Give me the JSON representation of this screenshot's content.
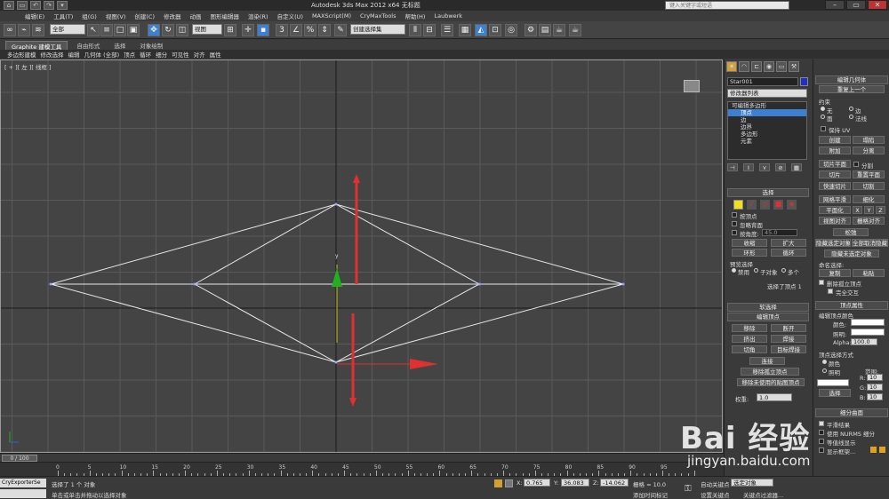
{
  "titlebar": {
    "title": "Autodesk 3ds Max  2012 x64     无标题",
    "search_placeholder": "键入关键字或短语",
    "quick_access": [
      "▭",
      "↶",
      "↷",
      "▾"
    ]
  },
  "menu": [
    "编辑(E)",
    "工具(T)",
    "组(G)",
    "视图(V)",
    "创建(C)",
    "修改器",
    "动画",
    "图形编辑器",
    "渲染(R)",
    "自定义(U)",
    "MAXScript(M)",
    "CryMaxTools",
    "帮助(H)",
    "Laubwerk"
  ],
  "toolbar": {
    "filter": "全部",
    "refcoord": "视图",
    "selection_set": "创建选择集"
  },
  "ribbon": {
    "tabs": [
      "Graphite 建模工具",
      "自由形式",
      "选择",
      "对象绘制"
    ],
    "subtabs": [
      "多边形建模",
      "修改选择",
      "编辑",
      "几何体 (全部)",
      "顶点",
      "循环",
      "细分",
      "可见性",
      "对齐",
      "属性"
    ]
  },
  "viewport": {
    "label": "[ + ][ 左 ][ 线框 ]",
    "axis_y": "y",
    "axis_x": "x"
  },
  "command_panel": {
    "object_name": "Star001",
    "modifier_list": "修改器列表",
    "stack": [
      {
        "label": "可编辑多边形",
        "type": "root"
      },
      {
        "label": "顶点",
        "type": "selected"
      },
      {
        "label": "边",
        "type": "sub"
      },
      {
        "label": "边界",
        "type": "sub"
      },
      {
        "label": "多边形",
        "type": "sub"
      },
      {
        "label": "元素",
        "type": "sub"
      }
    ],
    "selection": {
      "header": "选择",
      "by_vertex": "按顶点",
      "ignore_backface": "忽略背面",
      "by_angle": "按角度:",
      "angle_value": "45.0",
      "shrink": "收缩",
      "grow": "扩大",
      "ring": "环形",
      "loop": "循环",
      "preview_label": "预览选择",
      "preview_opts": [
        "禁用",
        "子对象",
        "多个"
      ],
      "status": "选择了顶点 1"
    },
    "soft_selection": "软选择",
    "edit_vertices": {
      "header": "编辑顶点",
      "buttons": [
        [
          "移除",
          "断开"
        ],
        [
          "挤出",
          "焊接"
        ],
        [
          "切角",
          "目标焊接"
        ]
      ],
      "connect": "连接",
      "remove_isolated": "移除孤立顶点",
      "remove_unused_map": "移除未使用的贴图顶点",
      "weight_label": "权重:",
      "weight_value": "1.0"
    }
  },
  "right_panel": {
    "edit_geometry": "编辑几何体",
    "repeat_last": "重复上一个",
    "constraints": "约束",
    "constraint_opts": [
      "无",
      "边",
      "面",
      "法线"
    ],
    "preserve_uv": "保持 UV",
    "create": "创建",
    "collapse": "塌陷",
    "attach": "附加",
    "detach": "分离",
    "slice_plane": "切片平面",
    "split": "分割",
    "slice": "切片",
    "reset_plane": "重置平面",
    "quickslice": "快速切片",
    "cut": "切割",
    "meshsmooth": "网格平滑",
    "tessellate": "细化",
    "planarize": "平面化",
    "xyz": [
      "X",
      "Y",
      "Z"
    ],
    "view_align": "视图对齐",
    "grid_align": "栅格对齐",
    "relax": "松弛",
    "hide_selected": "隐藏选定对象",
    "unhide_all": "全部取消隐藏",
    "hide_unselected": "隐藏未选定对象",
    "named_sel": "命名选择:",
    "copy": "复制",
    "paste": "粘贴",
    "delete_isolated": "删除孤立顶点",
    "full_interactivity": "完全交互",
    "vertex_props": "顶点属性",
    "edit_vertex_colors": "编辑顶点颜色",
    "color_label": "颜色:",
    "illum_label": "照明:",
    "alpha_label": "Alpha:",
    "alpha_value": "100.0",
    "select_by_vertex": "顶点选择方式",
    "opt_color": "颜色",
    "opt_illum": "照明",
    "range": "范围:",
    "r_label": "R:",
    "g_label": "G:",
    "b_label": "B:",
    "rgb_value": "10",
    "select_btn": "选择",
    "subdiv_surface": "细分曲面",
    "smooth_result": "平滑结果",
    "use_nurms": "使用 NURMS 细分",
    "isoline": "等值线显示",
    "show_cage": "显示框架..."
  },
  "timeline": {
    "frame": "0 / 100",
    "ticks": [
      0,
      5,
      10,
      15,
      20,
      25,
      30,
      35,
      40,
      45,
      50,
      55,
      60,
      65,
      70,
      75,
      80,
      85,
      90,
      95
    ]
  },
  "status": {
    "maxscript": "CryExporterSe",
    "line1": "选择了 1 个 对象",
    "line2": "单击或单击并拖动以选择对象",
    "x_label": "X:",
    "x_value": "0.765",
    "y_label": "Y:",
    "y_value": "36.083",
    "z_label": "Z:",
    "z_value": "-14.062",
    "grid": "栅格 = 10.0",
    "autokey": "自动关键点",
    "selected": "选定对象",
    "setkey": "设置关键点",
    "keyfilters": "关键点过滤器...",
    "add_time_tag": "添加时间标记"
  },
  "watermark": {
    "logo": "Bai 经验",
    "url": "jingyan.baidu.com"
  },
  "colors": {
    "accent": "#3d7fd0",
    "gizmo_red": "#e03030",
    "gizmo_green": "#20b020",
    "wire": "#e8e8e8"
  }
}
